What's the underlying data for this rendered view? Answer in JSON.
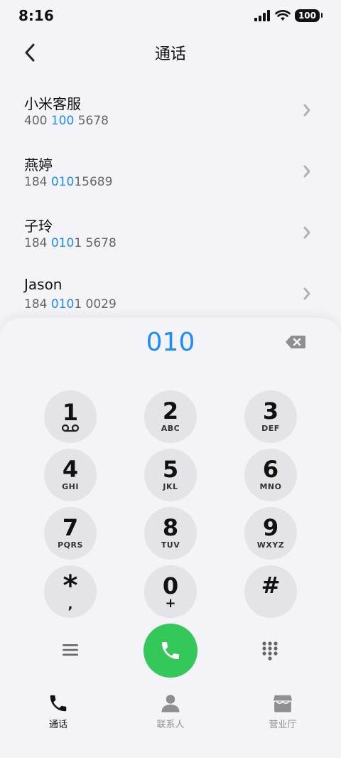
{
  "status_bar": {
    "time": "8:16",
    "battery": "100"
  },
  "header": {
    "title": "通话"
  },
  "contacts": [
    {
      "name": "小米客服",
      "number_parts": [
        "400 ",
        "100",
        " 5678"
      ]
    },
    {
      "name": "燕婷",
      "number_parts": [
        "184 ",
        "010",
        "15689"
      ]
    },
    {
      "name": "子玲",
      "number_parts": [
        "184 ",
        "010",
        "1 5678"
      ]
    },
    {
      "name": "Jason",
      "number_parts": [
        "184 ",
        "010",
        "1 0029"
      ]
    }
  ],
  "dial": {
    "input": "010"
  },
  "keypad": [
    {
      "digit": "1",
      "sub": ""
    },
    {
      "digit": "2",
      "sub": "ABC"
    },
    {
      "digit": "3",
      "sub": "DEF"
    },
    {
      "digit": "4",
      "sub": "GHI"
    },
    {
      "digit": "5",
      "sub": "JKL"
    },
    {
      "digit": "6",
      "sub": "MNO"
    },
    {
      "digit": "7",
      "sub": "PQRS"
    },
    {
      "digit": "8",
      "sub": "TUV"
    },
    {
      "digit": "9",
      "sub": "WXYZ"
    },
    {
      "digit": "*",
      "sub": ","
    },
    {
      "digit": "0",
      "sub": "+"
    },
    {
      "digit": "#",
      "sub": ""
    }
  ],
  "bottom_nav": [
    {
      "label": "通话",
      "icon": "phone-icon",
      "active": true
    },
    {
      "label": "联系人",
      "icon": "person-icon",
      "active": false
    },
    {
      "label": "营业厅",
      "icon": "store-icon",
      "active": false
    }
  ],
  "colors": {
    "accent": "#1a8cff",
    "call": "#34c759",
    "key_bg": "#e3e3e8"
  }
}
